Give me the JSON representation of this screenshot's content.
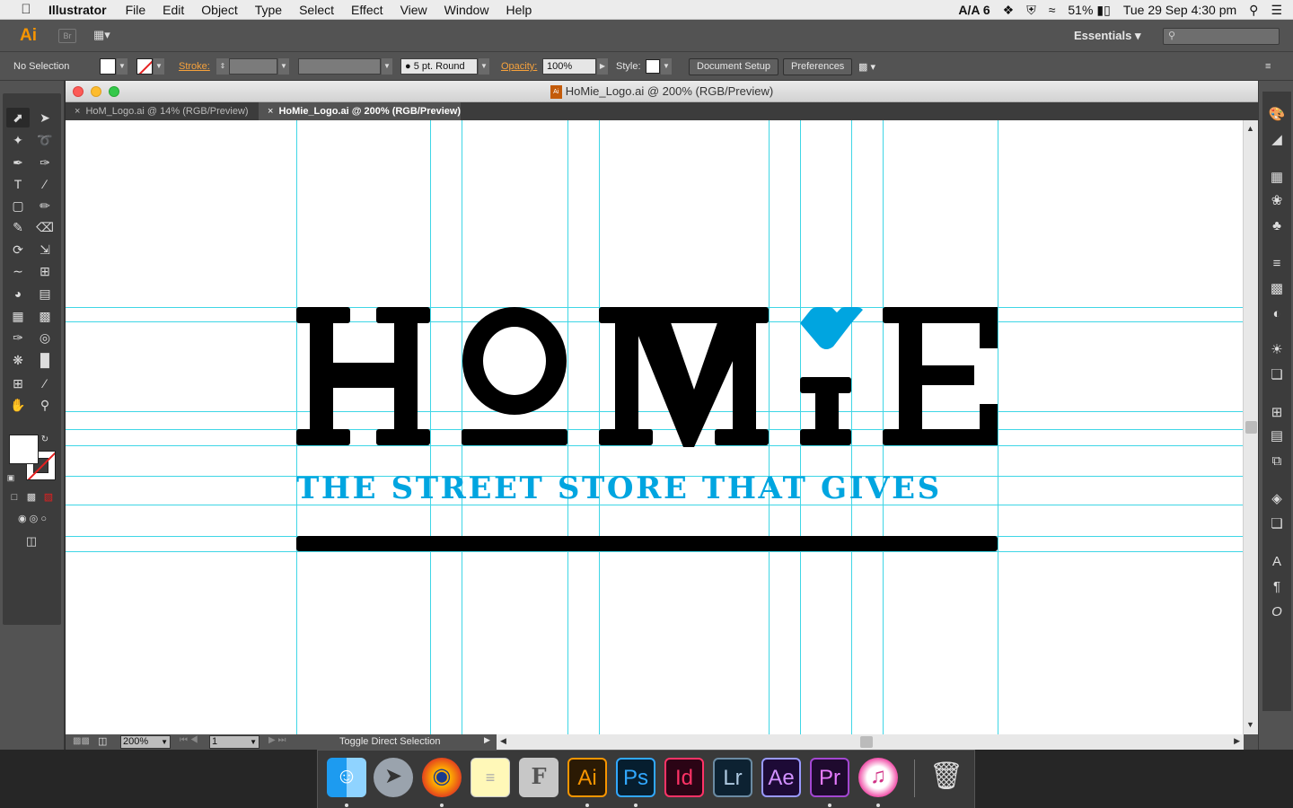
{
  "menubar": {
    "app_name": "Illustrator",
    "items": [
      "File",
      "Edit",
      "Object",
      "Type",
      "Select",
      "Effect",
      "View",
      "Window",
      "Help"
    ],
    "status": {
      "adobe_badge": "6",
      "battery": "51%",
      "datetime": "Tue 29 Sep  4:30 pm"
    }
  },
  "appbar": {
    "logo": "Ai",
    "bridge_label": "Br",
    "workspace": "Essentials",
    "search_placeholder": ""
  },
  "controlbar": {
    "selection_label": "No Selection",
    "stroke_label": "Stroke:",
    "brush_label": "5 pt. Round",
    "opacity_label": "Opacity:",
    "opacity_value": "100%",
    "style_label": "Style:",
    "document_setup": "Document Setup",
    "preferences": "Preferences"
  },
  "document": {
    "title": "HoMie_Logo.ai @ 200% (RGB/Preview)",
    "tabs": [
      {
        "label": "HoM_Logo.ai @ 14% (RGB/Preview)",
        "active": false
      },
      {
        "label": "HoMie_Logo.ai @ 200% (RGB/Preview)",
        "active": true
      }
    ],
    "zoom": "200%",
    "artboard_number": "1",
    "status_text": "Toggle Direct Selection"
  },
  "artwork": {
    "tagline": "THE STREET STORE THAT GIVES",
    "brand_color": "#00a5e0",
    "letter_color": "#000000"
  },
  "colors": {
    "guide": "#3fd6e6",
    "panel": "#535353",
    "accent": "#f79500"
  },
  "dock": {
    "apps": [
      {
        "name": "Finder",
        "label": "",
        "running": true
      },
      {
        "name": "Launchpad",
        "label": "",
        "running": false
      },
      {
        "name": "Firefox",
        "label": "",
        "running": true
      },
      {
        "name": "Notes",
        "label": "",
        "running": false
      },
      {
        "name": "Font Book",
        "label": "F",
        "running": false
      },
      {
        "name": "Illustrator",
        "label": "Ai",
        "running": true
      },
      {
        "name": "Photoshop",
        "label": "Ps",
        "running": true
      },
      {
        "name": "InDesign",
        "label": "Id",
        "running": false
      },
      {
        "name": "Lightroom",
        "label": "Lr",
        "running": false
      },
      {
        "name": "After Effects",
        "label": "Ae",
        "running": false
      },
      {
        "name": "Premiere Pro",
        "label": "Pr",
        "running": true
      },
      {
        "name": "iTunes",
        "label": "",
        "running": true
      }
    ]
  }
}
